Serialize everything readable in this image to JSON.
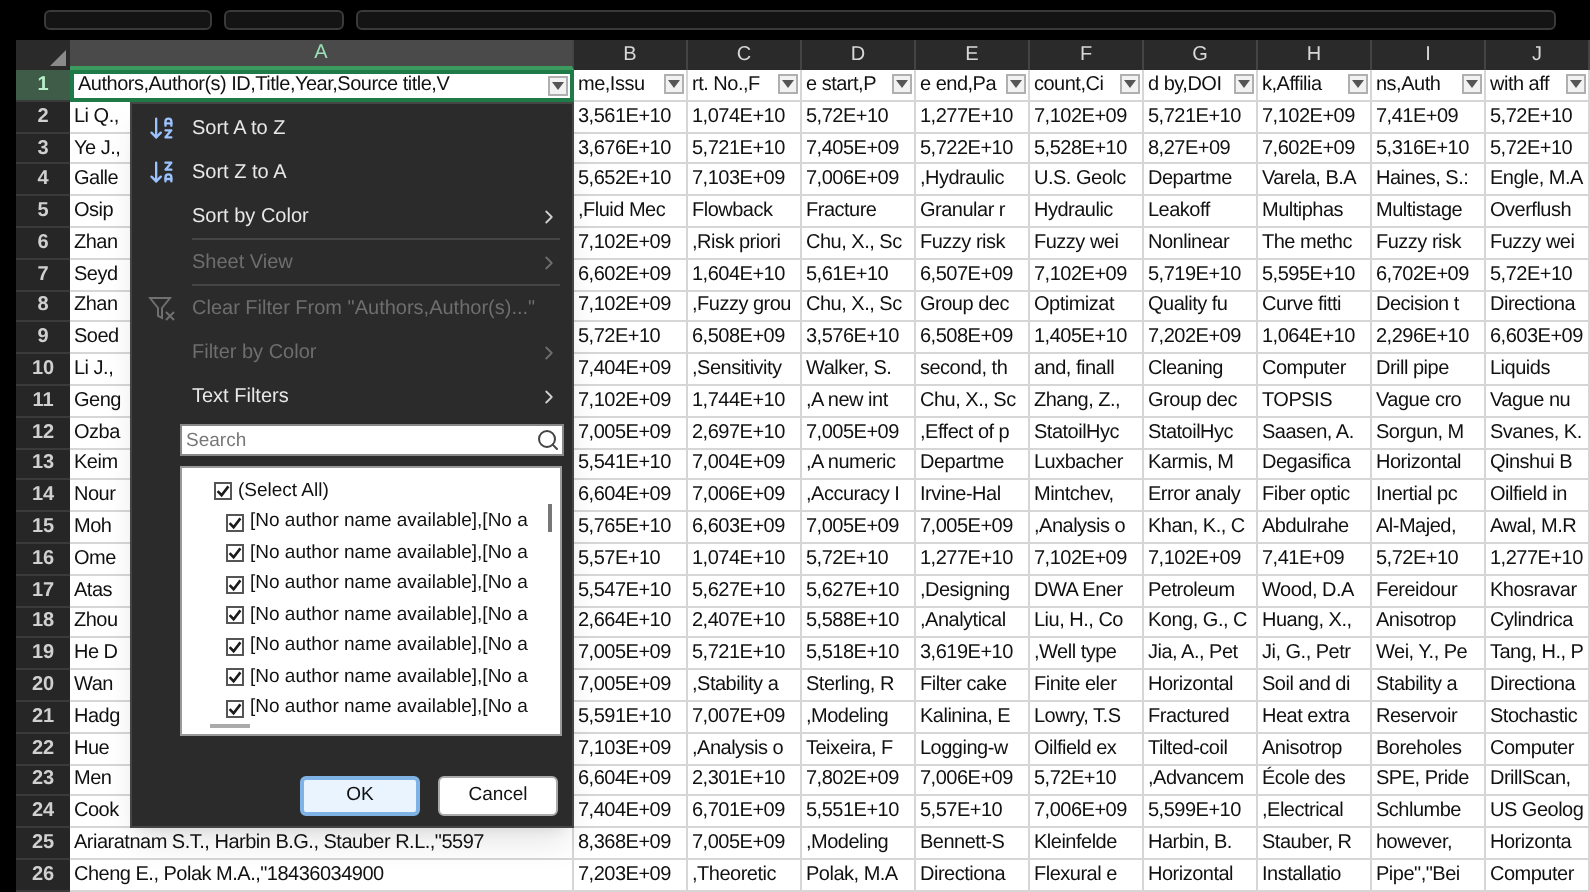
{
  "columns": [
    {
      "label": "A",
      "selected": true
    },
    {
      "label": "B",
      "selected": false
    },
    {
      "label": "C",
      "selected": false
    },
    {
      "label": "D",
      "selected": false
    },
    {
      "label": "E",
      "selected": false
    },
    {
      "label": "F",
      "selected": false
    },
    {
      "label": "G",
      "selected": false
    },
    {
      "label": "H",
      "selected": false
    },
    {
      "label": "I",
      "selected": false
    },
    {
      "label": "J",
      "selected": false
    }
  ],
  "rows": [
    {
      "number": "1",
      "selected": true,
      "kind": "filter_header",
      "cells": [
        "Authors,Author(s) ID,Title,Year,Source title,V",
        "me,Issu",
        "rt. No.,F",
        "e start,P",
        "e end,Pa",
        "count,Ci",
        "d by,DOI",
        "k,Affilia",
        "ns,Auth",
        "with aff"
      ]
    },
    {
      "number": "2",
      "selected": false,
      "kind": "data",
      "cells": [
        "Li Q.,",
        "3,561E+10",
        "1,074E+10",
        "5,72E+10",
        "1,277E+10",
        "7,102E+09",
        "5,721E+10",
        "7,102E+09",
        "7,41E+09",
        "5,72E+10"
      ]
    },
    {
      "number": "3",
      "selected": false,
      "kind": "data",
      "cells": [
        "Ye J.,",
        "3,676E+10",
        "5,721E+10",
        "7,405E+09",
        "5,722E+10",
        "5,528E+10",
        "8,27E+09",
        "7,602E+09",
        "5,316E+10",
        "5,72E+10"
      ]
    },
    {
      "number": "4",
      "selected": false,
      "kind": "data",
      "cells": [
        "Galle",
        "5,652E+10",
        "7,103E+09",
        "7,006E+09",
        ",Hydraulic",
        "U.S. Geolc",
        "Departme",
        "Varela, B.A",
        "Haines, S.:",
        "Engle, M.A"
      ]
    },
    {
      "number": "5",
      "selected": false,
      "kind": "data",
      "cells": [
        "Osip",
        ",Fluid Mec",
        "Flowback",
        "Fracture",
        "Granular r",
        "Hydraulic",
        "Leakoff",
        "Multiphas",
        "Multistage",
        "Overflush"
      ]
    },
    {
      "number": "6",
      "selected": false,
      "kind": "data",
      "cells": [
        "Zhan",
        "7,102E+09",
        ",Risk priori",
        "Chu, X., Sc",
        "Fuzzy risk",
        "Fuzzy wei",
        "Nonlinear",
        "The methc",
        "Fuzzy risk",
        "Fuzzy wei"
      ]
    },
    {
      "number": "7",
      "selected": false,
      "kind": "data",
      "cells": [
        "Seyd",
        "6,602E+09",
        "1,604E+10",
        "5,61E+10",
        "6,507E+09",
        "7,102E+09",
        "5,719E+10",
        "5,595E+10",
        "6,702E+09",
        "5,72E+10"
      ]
    },
    {
      "number": "8",
      "selected": false,
      "kind": "data",
      "cells": [
        "Zhan",
        "7,102E+09",
        ",Fuzzy grou",
        "Chu, X., Sc",
        "Group dec",
        "Optimizat",
        "Quality fu",
        "Curve fitti",
        "Decision t",
        "Directiona"
      ]
    },
    {
      "number": "9",
      "selected": false,
      "kind": "data",
      "cells": [
        "Soed",
        "5,72E+10",
        "6,508E+09",
        "3,576E+10",
        "6,508E+09",
        "1,405E+10",
        "7,202E+09",
        "1,064E+10",
        "2,296E+10",
        "6,603E+09"
      ]
    },
    {
      "number": "10",
      "selected": false,
      "kind": "data",
      "cells": [
        "Li J.,",
        "7,404E+09",
        ",Sensitivity",
        "Walker, S.",
        "second, th",
        "and, finall",
        "Cleaning",
        "Computer",
        "Drill pipe",
        "Liquids"
      ]
    },
    {
      "number": "11",
      "selected": false,
      "kind": "data",
      "cells": [
        "Geng",
        "7,102E+09",
        "1,744E+10",
        ",A new int",
        "Chu, X., Sc",
        "Zhang, Z.,",
        "Group dec",
        "TOPSIS",
        "Vague cro",
        "Vague nu"
      ]
    },
    {
      "number": "12",
      "selected": false,
      "kind": "data",
      "cells": [
        "Ozba",
        "7,005E+09",
        "2,697E+10",
        "7,005E+09",
        ",Effect of p",
        "StatoilHyc",
        "StatoilHyc",
        "Saasen, A.",
        "Sorgun, M",
        "Svanes, K."
      ]
    },
    {
      "number": "13",
      "selected": false,
      "kind": "data",
      "cells": [
        "Keim",
        "5,541E+10",
        "7,004E+09",
        ",A numeric",
        "Departme",
        "Luxbacher",
        "Karmis, M",
        "Degasifica",
        "Horizontal",
        "Qinshui B"
      ]
    },
    {
      "number": "14",
      "selected": false,
      "kind": "data",
      "cells": [
        "Nour",
        "6,604E+09",
        "7,006E+09",
        ",Accuracy I",
        "Irvine-Hal",
        "Mintchev,",
        "Error analy",
        "Fiber optic",
        "Inertial pc",
        "Oilfield in"
      ]
    },
    {
      "number": "15",
      "selected": false,
      "kind": "data",
      "cells": [
        "Moh",
        "5,765E+10",
        "6,603E+09",
        "7,005E+09",
        "7,005E+09",
        ",Analysis o",
        "Khan, K., C",
        "Abdulrahe",
        "Al-Majed,",
        "Awal, M.R"
      ]
    },
    {
      "number": "16",
      "selected": false,
      "kind": "data",
      "cells": [
        "Ome",
        "5,57E+10",
        "1,074E+10",
        "5,72E+10",
        "1,277E+10",
        "7,102E+09",
        "7,102E+09",
        "7,41E+09",
        "5,72E+10",
        "1,277E+10"
      ]
    },
    {
      "number": "17",
      "selected": false,
      "kind": "data",
      "cells": [
        "Atas",
        "5,547E+10",
        "5,627E+10",
        "5,627E+10",
        ",Designing",
        "DWA Ener",
        "Petroleum",
        "Wood, D.A",
        "Fereidour",
        "Khosravar"
      ]
    },
    {
      "number": "18",
      "selected": false,
      "kind": "data",
      "cells": [
        "Zhou",
        "2,664E+10",
        "2,407E+10",
        "5,588E+10",
        ",Analytical",
        "Liu, H., Co",
        "Kong, G., C",
        "Huang, X.,",
        "Anisotrop",
        "Cylindrica"
      ]
    },
    {
      "number": "19",
      "selected": false,
      "kind": "data",
      "cells": [
        "He D",
        "7,005E+09",
        "5,721E+10",
        "5,518E+10",
        "3,619E+10",
        ",Well type",
        "Jia, A., Pet",
        "Ji, G., Petr",
        "Wei, Y., Pe",
        "Tang, H., P"
      ]
    },
    {
      "number": "20",
      "selected": false,
      "kind": "data",
      "cells": [
        "Wan",
        "7,005E+09",
        ",Stability a",
        "Sterling, R",
        "Filter cake",
        "Finite eler",
        "Horizontal",
        "Soil and di",
        "Stability a",
        "Directiona"
      ]
    },
    {
      "number": "21",
      "selected": false,
      "kind": "data",
      "cells": [
        "Hadg",
        "5,591E+10",
        "7,007E+09",
        ",Modeling",
        "Kalinina, E",
        "Lowry, T.S",
        "Fractured",
        "Heat extra",
        "Reservoir",
        "Stochastic"
      ]
    },
    {
      "number": "22",
      "selected": false,
      "kind": "data",
      "cells": [
        "Hue",
        "7,103E+09",
        ",Analysis o",
        "Teixeira, F",
        "Logging-w",
        "Oilfield ex",
        "Tilted-coil",
        "Anisotrop",
        "Boreholes",
        "Computer"
      ]
    },
    {
      "number": "23",
      "selected": false,
      "kind": "data",
      "cells": [
        "Men",
        "6,604E+09",
        "2,301E+10",
        "7,802E+09",
        "7,006E+09",
        "5,72E+10",
        ",Advancem",
        "École des",
        "SPE, Pride",
        "DrillScan,"
      ]
    },
    {
      "number": "24",
      "selected": false,
      "kind": "data",
      "cells": [
        "Cook",
        "7,404E+09",
        "6,701E+09",
        "5,551E+10",
        "5,57E+10",
        "7,006E+09",
        "5,599E+10",
        ",Electrical",
        "Schlumbe",
        "US Geolog"
      ]
    },
    {
      "number": "25",
      "selected": false,
      "kind": "data",
      "cells": [
        "Ariaratnam S.T., Harbin B.G., Stauber R.L.,\"5597",
        "8,368E+09",
        "7,005E+09",
        ",Modeling",
        "Bennett-S",
        "Kleinfelde",
        "Harbin, B.",
        "Stauber, R",
        "however,",
        "Horizonta"
      ]
    },
    {
      "number": "26",
      "selected": false,
      "kind": "data",
      "cells": [
        "Cheng E., Polak M.A.,\"18436034900",
        "7,203E+09",
        ",Theoretic",
        "Polak, M.A",
        "Directiona",
        "Flexural e",
        "Horizontal",
        "Installatio",
        "Pipe\",\"Bei",
        "Computer"
      ]
    }
  ],
  "filter_menu": {
    "items": [
      {
        "label": "Sort A to Z",
        "kind": "sort_ascending",
        "disabled": false,
        "submenu": false
      },
      {
        "label": "Sort Z to A",
        "kind": "sort_descending",
        "disabled": false,
        "submenu": false
      },
      {
        "label": "Sort by Color",
        "kind": "plain",
        "disabled": false,
        "submenu": true
      },
      {
        "label": "Sheet View",
        "kind": "plain",
        "disabled": true,
        "submenu": true
      },
      {
        "label": "Clear Filter From \"Authors,Author(s)...\"",
        "kind": "clear_filter",
        "disabled": true,
        "submenu": false
      },
      {
        "label": "Filter by Color",
        "kind": "plain",
        "disabled": true,
        "submenu": true
      },
      {
        "label": "Text Filters",
        "kind": "plain",
        "disabled": false,
        "submenu": true
      }
    ],
    "search": {
      "placeholder": "Search"
    },
    "list": [
      {
        "label": "(Select All)",
        "checked": true,
        "kind": "all"
      },
      {
        "label": "[No author name available],[No a",
        "checked": true,
        "kind": "value"
      },
      {
        "label": "[No author name available],[No a",
        "checked": true,
        "kind": "value"
      },
      {
        "label": "[No author name available],[No a",
        "checked": true,
        "kind": "value"
      },
      {
        "label": "[No author name available],[No a",
        "checked": true,
        "kind": "value"
      },
      {
        "label": "[No author name available],[No a",
        "checked": true,
        "kind": "value"
      },
      {
        "label": "[No author name available],[No a",
        "checked": true,
        "kind": "value"
      },
      {
        "label": "[No author name available],[No a",
        "checked": true,
        "kind": "value"
      }
    ],
    "buttons": [
      {
        "label": "OK",
        "kind": "primary"
      },
      {
        "label": "Cancel",
        "kind": "secondary"
      }
    ]
  }
}
